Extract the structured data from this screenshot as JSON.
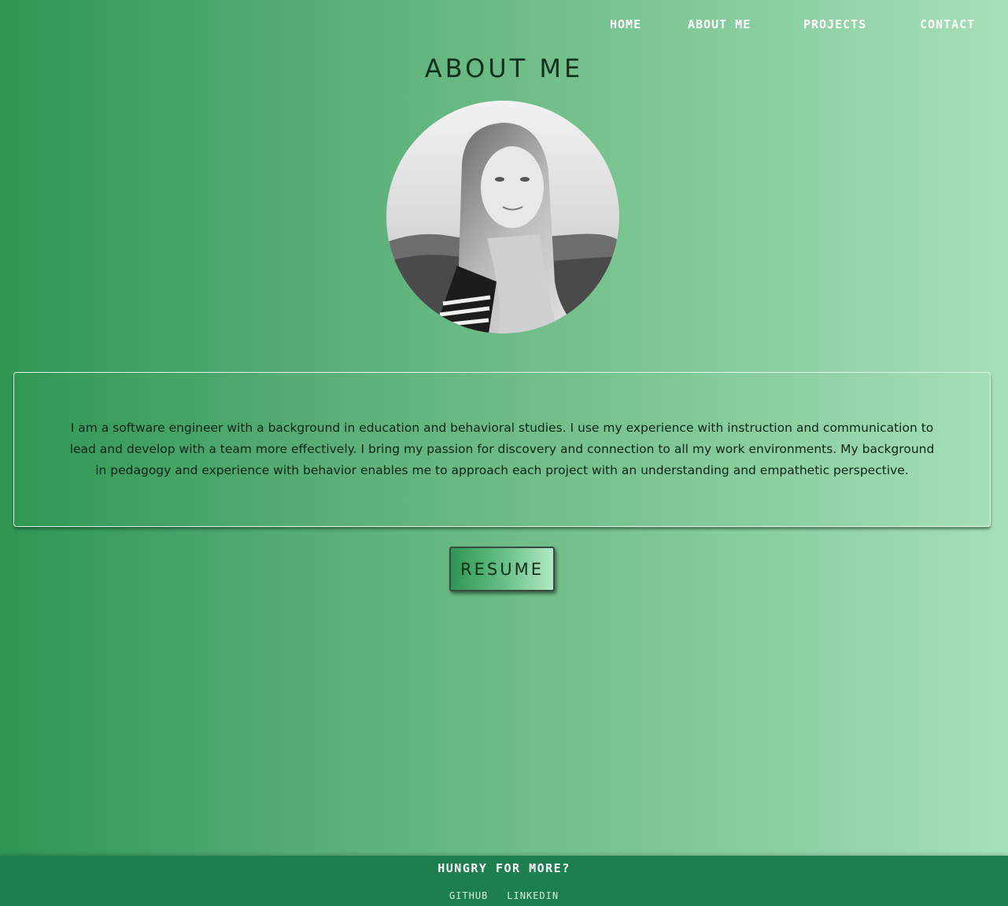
{
  "nav": {
    "items": [
      {
        "label": "HOME"
      },
      {
        "label": "ABOUT ME"
      },
      {
        "label": "PROJECTS"
      },
      {
        "label": "CONTACT"
      }
    ]
  },
  "page": {
    "title": "ABOUT ME"
  },
  "profile": {
    "photo_icon": "profile-photo",
    "bio": "I am a software engineer with a background in education and behavioral studies. I use my experience with instruction and communication to lead and develop with a team more effectively. I bring my passion for discovery and connection to all my work environments. My background in pedagogy and experience with behavior enables me to approach each project with an understanding and empathetic perspective."
  },
  "actions": {
    "resume_label": "RESUME"
  },
  "footer": {
    "heading": "HUNGRY FOR MORE?",
    "links": [
      {
        "label": "GITHUB"
      },
      {
        "label": "LINKEDIN"
      }
    ]
  },
  "colors": {
    "gradient_start": "#2e9653",
    "gradient_end": "#a6e0b9",
    "footer_bg": "#1d7f4d",
    "text_dark": "#14301d"
  }
}
